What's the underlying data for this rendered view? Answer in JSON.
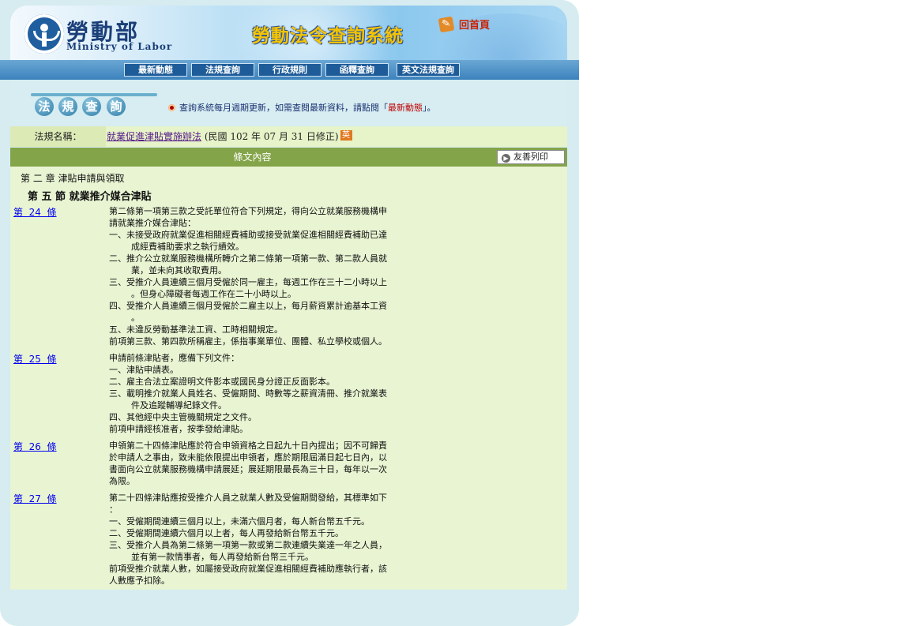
{
  "header": {
    "ministry_cn": "勞動部",
    "ministry_en": "Ministry of Labor",
    "system_title": "勞動法令查詢系統",
    "home_label": "回首頁"
  },
  "nav": [
    "最新動態",
    "法規查詢",
    "行政規則",
    "函釋查詢",
    "英文法規查詢"
  ],
  "section_heading": [
    "法",
    "規",
    "查",
    "詢"
  ],
  "notice": {
    "prefix": "查詢系統每月週期更新，如需查閱最新資料，請點閱「",
    "highlight": "最新動態",
    "suffix": "」。"
  },
  "law": {
    "label": "法規名稱：",
    "name": "就業促進津貼實施辦法",
    "date": " (民國 102 年 07 月 31 日修正)",
    "en_badge": "英"
  },
  "content_header": {
    "title": "條文內容",
    "print_label": "友善列印"
  },
  "chapter": "第 二 章 津貼申請與領取",
  "section": "第 五 節 就業推介媒合津貼",
  "articles": [
    {
      "num": "第  24  條",
      "lines": [
        {
          "t": "第二條第一項第三款之受託單位符合下列規定，得向公立就業服務機構申",
          "i": false
        },
        {
          "t": "請就業推介媒合津貼：",
          "i": false
        },
        {
          "t": "一、未接受政府就業促進相關經費補助或接受就業促進相關經費補助已達",
          "i": false
        },
        {
          "t": "成經費補助要求之執行績效。",
          "i": true
        },
        {
          "t": "二、推介公立就業服務機構所轉介之第二條第一項第一款、第二款人員就",
          "i": false
        },
        {
          "t": "業，並未向其收取費用。",
          "i": true
        },
        {
          "t": "三、受推介人員連續三個月受僱於同一雇主，每週工作在三十二小時以上",
          "i": false
        },
        {
          "t": "。但身心障礙者每週工作在二十小時以上。",
          "i": true
        },
        {
          "t": "四、受推介人員連續三個月受僱於二雇主以上，每月薪資累計逾基本工資",
          "i": false
        },
        {
          "t": "。",
          "i": true
        },
        {
          "t": "五、未違反勞動基準法工資、工時相關規定。",
          "i": false
        },
        {
          "t": "前項第三款、第四款所稱雇主，係指事業單位、團體、私立學校或個人。",
          "i": false
        }
      ]
    },
    {
      "num": "第  25  條",
      "lines": [
        {
          "t": "申請前條津貼者，應備下列文件：",
          "i": false
        },
        {
          "t": "一、津貼申請表。",
          "i": false
        },
        {
          "t": "二、雇主合法立案證明文件影本或國民身分證正反面影本。",
          "i": false
        },
        {
          "t": "三、載明推介就業人員姓名、受僱期間、時數等之薪資清冊、推介就業表",
          "i": false
        },
        {
          "t": "件及追蹤輔導紀錄文件。",
          "i": true
        },
        {
          "t": "四、其他經中央主管機關規定之文件。",
          "i": false
        },
        {
          "t": "前項申請經核准者，按季發給津貼。",
          "i": false
        }
      ]
    },
    {
      "num": "第  26  條",
      "lines": [
        {
          "t": "申領第二十四條津貼應於符合申領資格之日起九十日內提出；因不可歸責",
          "i": false
        },
        {
          "t": "於申請人之事由，致未能依限提出申領者，應於期限屆滿日起七日內，以",
          "i": false
        },
        {
          "t": "書面向公立就業服務機構申請展延；展延期限最長為三十日，每年以一次",
          "i": false
        },
        {
          "t": "為限。",
          "i": false
        }
      ]
    },
    {
      "num": "第  27  條",
      "lines": [
        {
          "t": "第二十四條津貼應按受推介人員之就業人數及受僱期間發給，其標準如下",
          "i": false
        },
        {
          "t": "：",
          "i": false
        },
        {
          "t": "一、受僱期間連續三個月以上，未滿六個月者，每人新台幣五千元。",
          "i": false
        },
        {
          "t": "二、受僱期間連續六個月以上者，每人再發給新台幣五千元。",
          "i": false
        },
        {
          "t": "三、受推介人員為第二條第一項第一款或第二款連續失業達一年之人員，",
          "i": false
        },
        {
          "t": "並有第一款情事者，每人再發給新台幣三千元。",
          "i": true
        },
        {
          "t": "前項受推介就業人數，如屬接受政府就業促進相關經費補助應執行者，該",
          "i": false
        },
        {
          "t": "人數應予扣除。",
          "i": false
        }
      ]
    }
  ]
}
